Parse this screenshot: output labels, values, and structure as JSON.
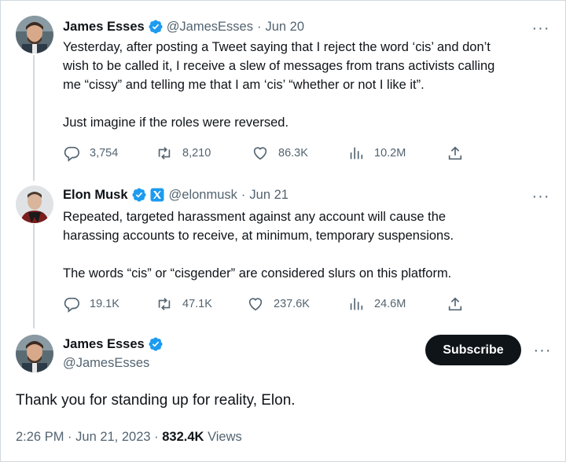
{
  "tweets": [
    {
      "name": "James Esses",
      "handle": "@JamesEsses",
      "sep": "·",
      "date": "Jun 20",
      "text": "Yesterday, after posting a Tweet saying that I reject the word ‘cis’ and don’t\nwish to be called it, I receive a slew of messages from trans activists calling\nme “cissy” and telling me that I am ‘cis’ “whether or not I like it”.\n\nJust imagine if the roles were reversed.",
      "replies": "3,754",
      "retweets": "8,210",
      "likes": "86.3K",
      "views": "10.2M"
    },
    {
      "name": "Elon Musk",
      "handle": "@elonmusk",
      "sep": "·",
      "date": "Jun 21",
      "text": "Repeated, targeted harassment against any account will cause the\nharassing accounts to receive, at minimum, temporary suspensions.\n\nThe words “cis” or “cisgender” are considered slurs on this platform.",
      "replies": "19.1K",
      "retweets": "47.1K",
      "likes": "237.6K",
      "views": "24.6M"
    }
  ],
  "main_tweet": {
    "name": "James Esses",
    "handle": "@JamesEsses",
    "subscribe_label": "Subscribe",
    "text": "Thank you for standing up for reality, Elon.",
    "time": "2:26 PM",
    "date": "Jun 21, 2023",
    "sep": "·",
    "views_count": "832.4K",
    "views_label": "Views"
  },
  "more_label": "···",
  "colors": {
    "verified_blue": "#1d9bf0",
    "text": "#0f1419",
    "secondary": "#536471",
    "button": "#0f1419"
  }
}
